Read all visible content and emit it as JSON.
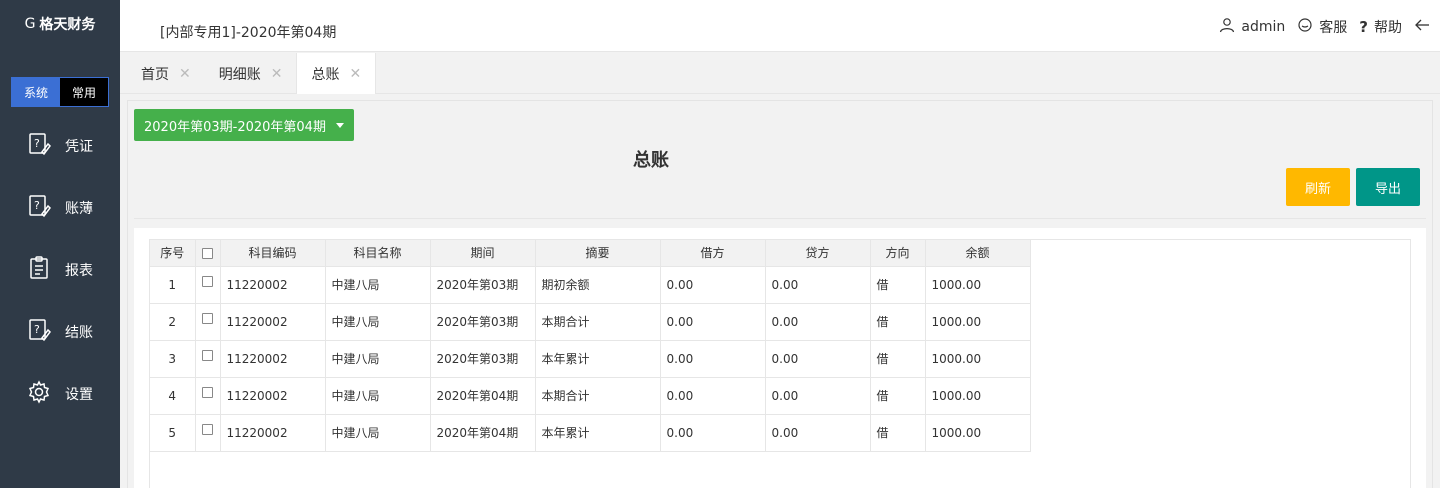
{
  "app": {
    "logo_mark": "G",
    "logo_text": "格天财务"
  },
  "sidebar": {
    "mode": {
      "system": "系统",
      "common": "常用"
    },
    "items": [
      {
        "label": "凭证",
        "icon": "voucher-icon"
      },
      {
        "label": "账薄",
        "icon": "ledger-icon"
      },
      {
        "label": "报表",
        "icon": "report-icon"
      },
      {
        "label": "结账",
        "icon": "close-account-icon"
      },
      {
        "label": "设置",
        "icon": "gear-icon"
      }
    ]
  },
  "header": {
    "period_title": "[内部专用1]-2020年第04期",
    "user": "admin",
    "service": "客服",
    "help": "帮助"
  },
  "tabs": [
    {
      "label": "首页",
      "active": false
    },
    {
      "label": "明细账",
      "active": false
    },
    {
      "label": "总账",
      "active": true
    }
  ],
  "main": {
    "period_range": "2020年第03期-2020年第04期",
    "title": "总账",
    "refresh_label": "刷新",
    "export_label": "导出"
  },
  "table": {
    "columns": [
      "序号",
      "",
      "科目编码",
      "科目名称",
      "期间",
      "摘要",
      "借方",
      "贷方",
      "方向",
      "余额"
    ],
    "rows": [
      [
        "1",
        "",
        "11220002",
        "中建八局",
        "2020年第03期",
        "期初余额",
        "0.00",
        "0.00",
        "借",
        "1000.00"
      ],
      [
        "2",
        "",
        "11220002",
        "中建八局",
        "2020年第03期",
        "本期合计",
        "0.00",
        "0.00",
        "借",
        "1000.00"
      ],
      [
        "3",
        "",
        "11220002",
        "中建八局",
        "2020年第03期",
        "本年累计",
        "0.00",
        "0.00",
        "借",
        "1000.00"
      ],
      [
        "4",
        "",
        "11220002",
        "中建八局",
        "2020年第04期",
        "本期合计",
        "0.00",
        "0.00",
        "借",
        "1000.00"
      ],
      [
        "5",
        "",
        "11220002",
        "中建八局",
        "2020年第04期",
        "本年累计",
        "0.00",
        "0.00",
        "借",
        "1000.00"
      ]
    ]
  },
  "colors": {
    "sidebar_bg": "#2f3a47",
    "accent_blue": "#3b6fd4",
    "dropdown_green": "#45b04b",
    "refresh_yellow": "#ffb800",
    "export_teal": "#009688"
  }
}
